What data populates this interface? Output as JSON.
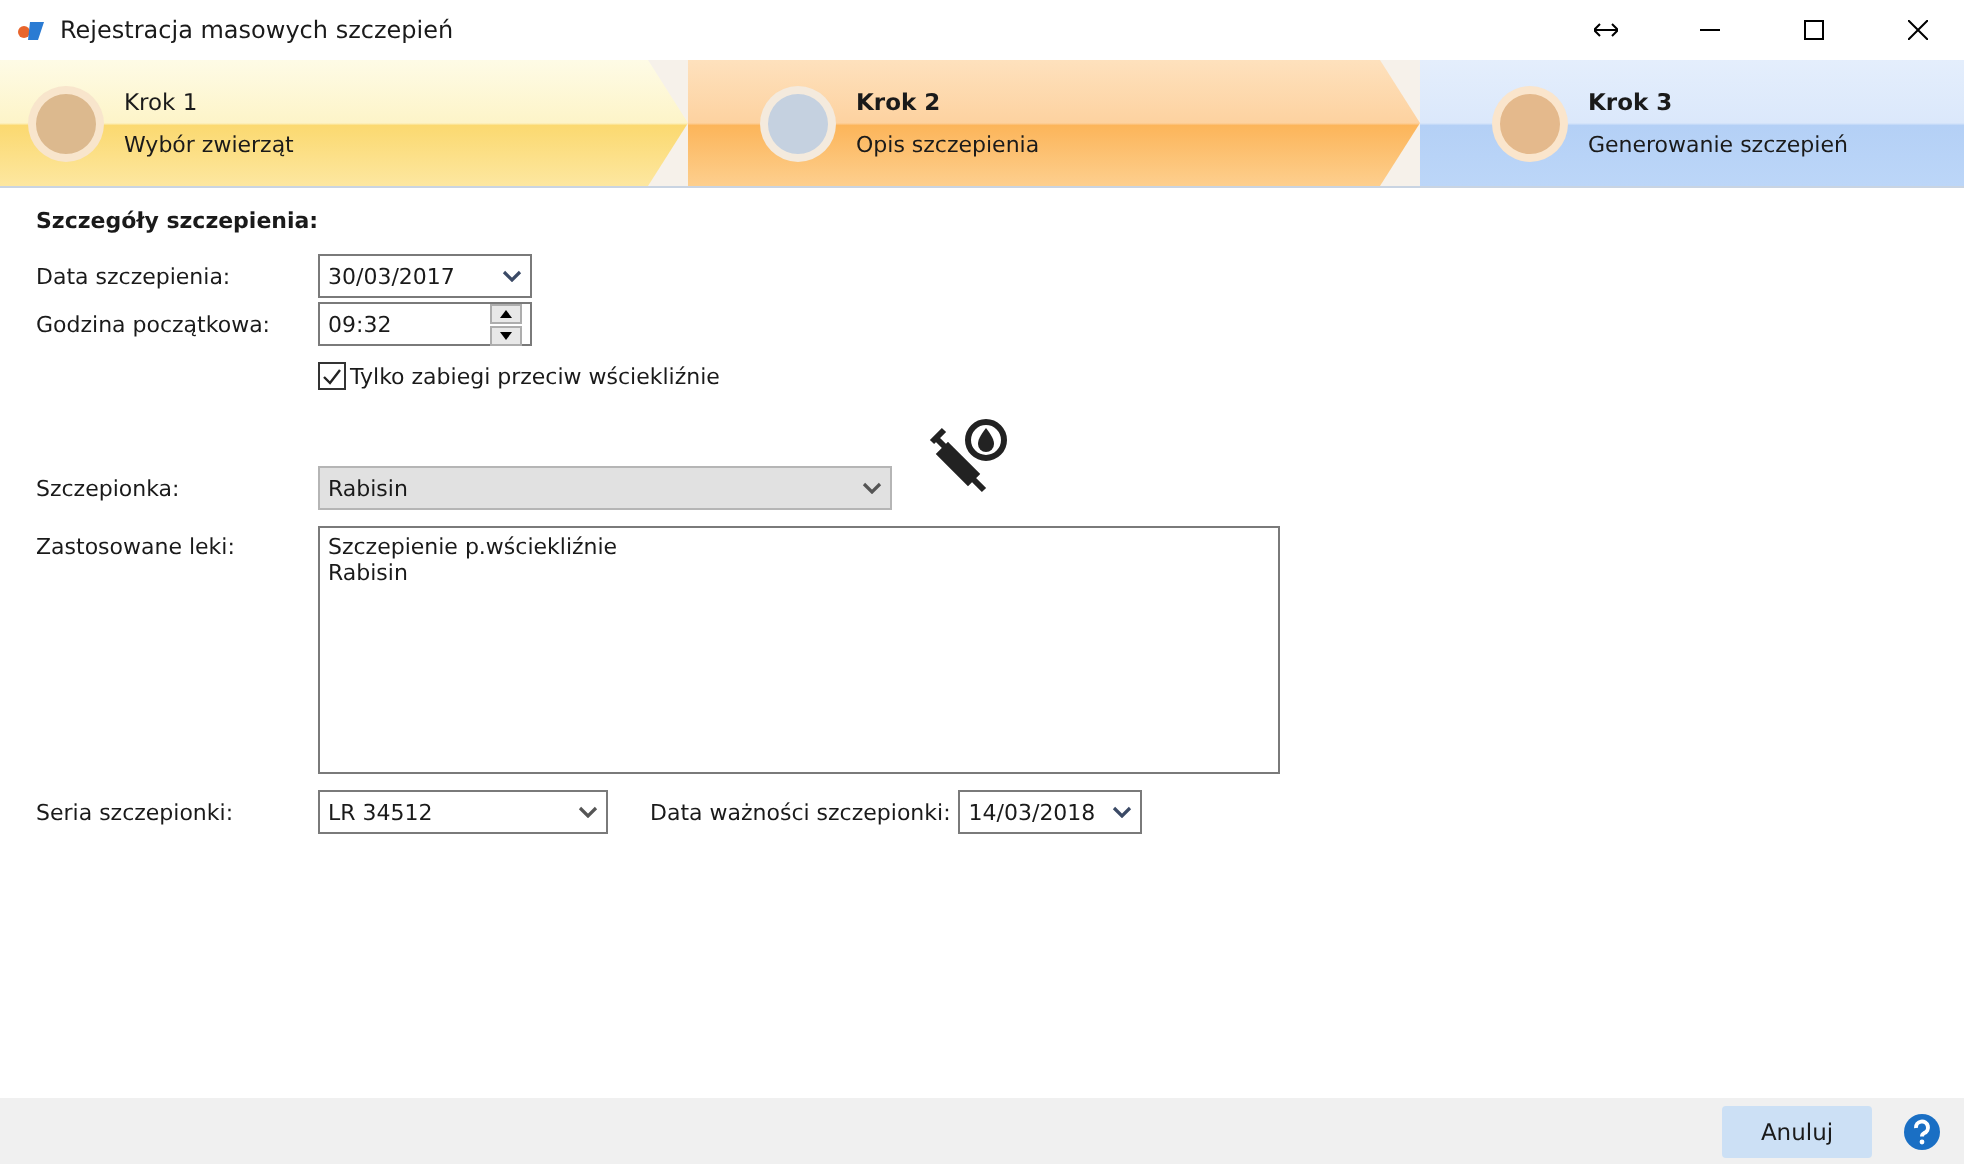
{
  "window": {
    "title": "Rejestracja masowych szczepień"
  },
  "steps": [
    {
      "title": "Krok 1",
      "subtitle": "Wybór zwierząt",
      "kind": "done"
    },
    {
      "title": "Krok 2",
      "subtitle": "Opis szczepienia",
      "kind": "current"
    },
    {
      "title": "Krok 3",
      "subtitle": "Generowanie szczepień",
      "kind": "pending"
    }
  ],
  "section_title": "Szczegóły szczepienia:",
  "date": {
    "label": "Data szczepienia:",
    "value": "30/03/2017"
  },
  "time": {
    "label": "Godzina początkowa:",
    "value": "09:32"
  },
  "rabies_only": {
    "label": "Tylko zabiegi przeciw wściekliźnie",
    "checked": true
  },
  "vaccine": {
    "label": "Szczepionka:",
    "value": "Rabisin"
  },
  "drugs": {
    "label": "Zastosowane leki:",
    "lines": [
      "Szczepienie p.wściekliźnie",
      "Rabisin"
    ]
  },
  "series": {
    "label": "Seria szczepionki:",
    "value": "LR 34512"
  },
  "expiry": {
    "label": "Data ważności szczepionki:",
    "value": "14/03/2018"
  },
  "buttons": [
    "Anuluj"
  ]
}
